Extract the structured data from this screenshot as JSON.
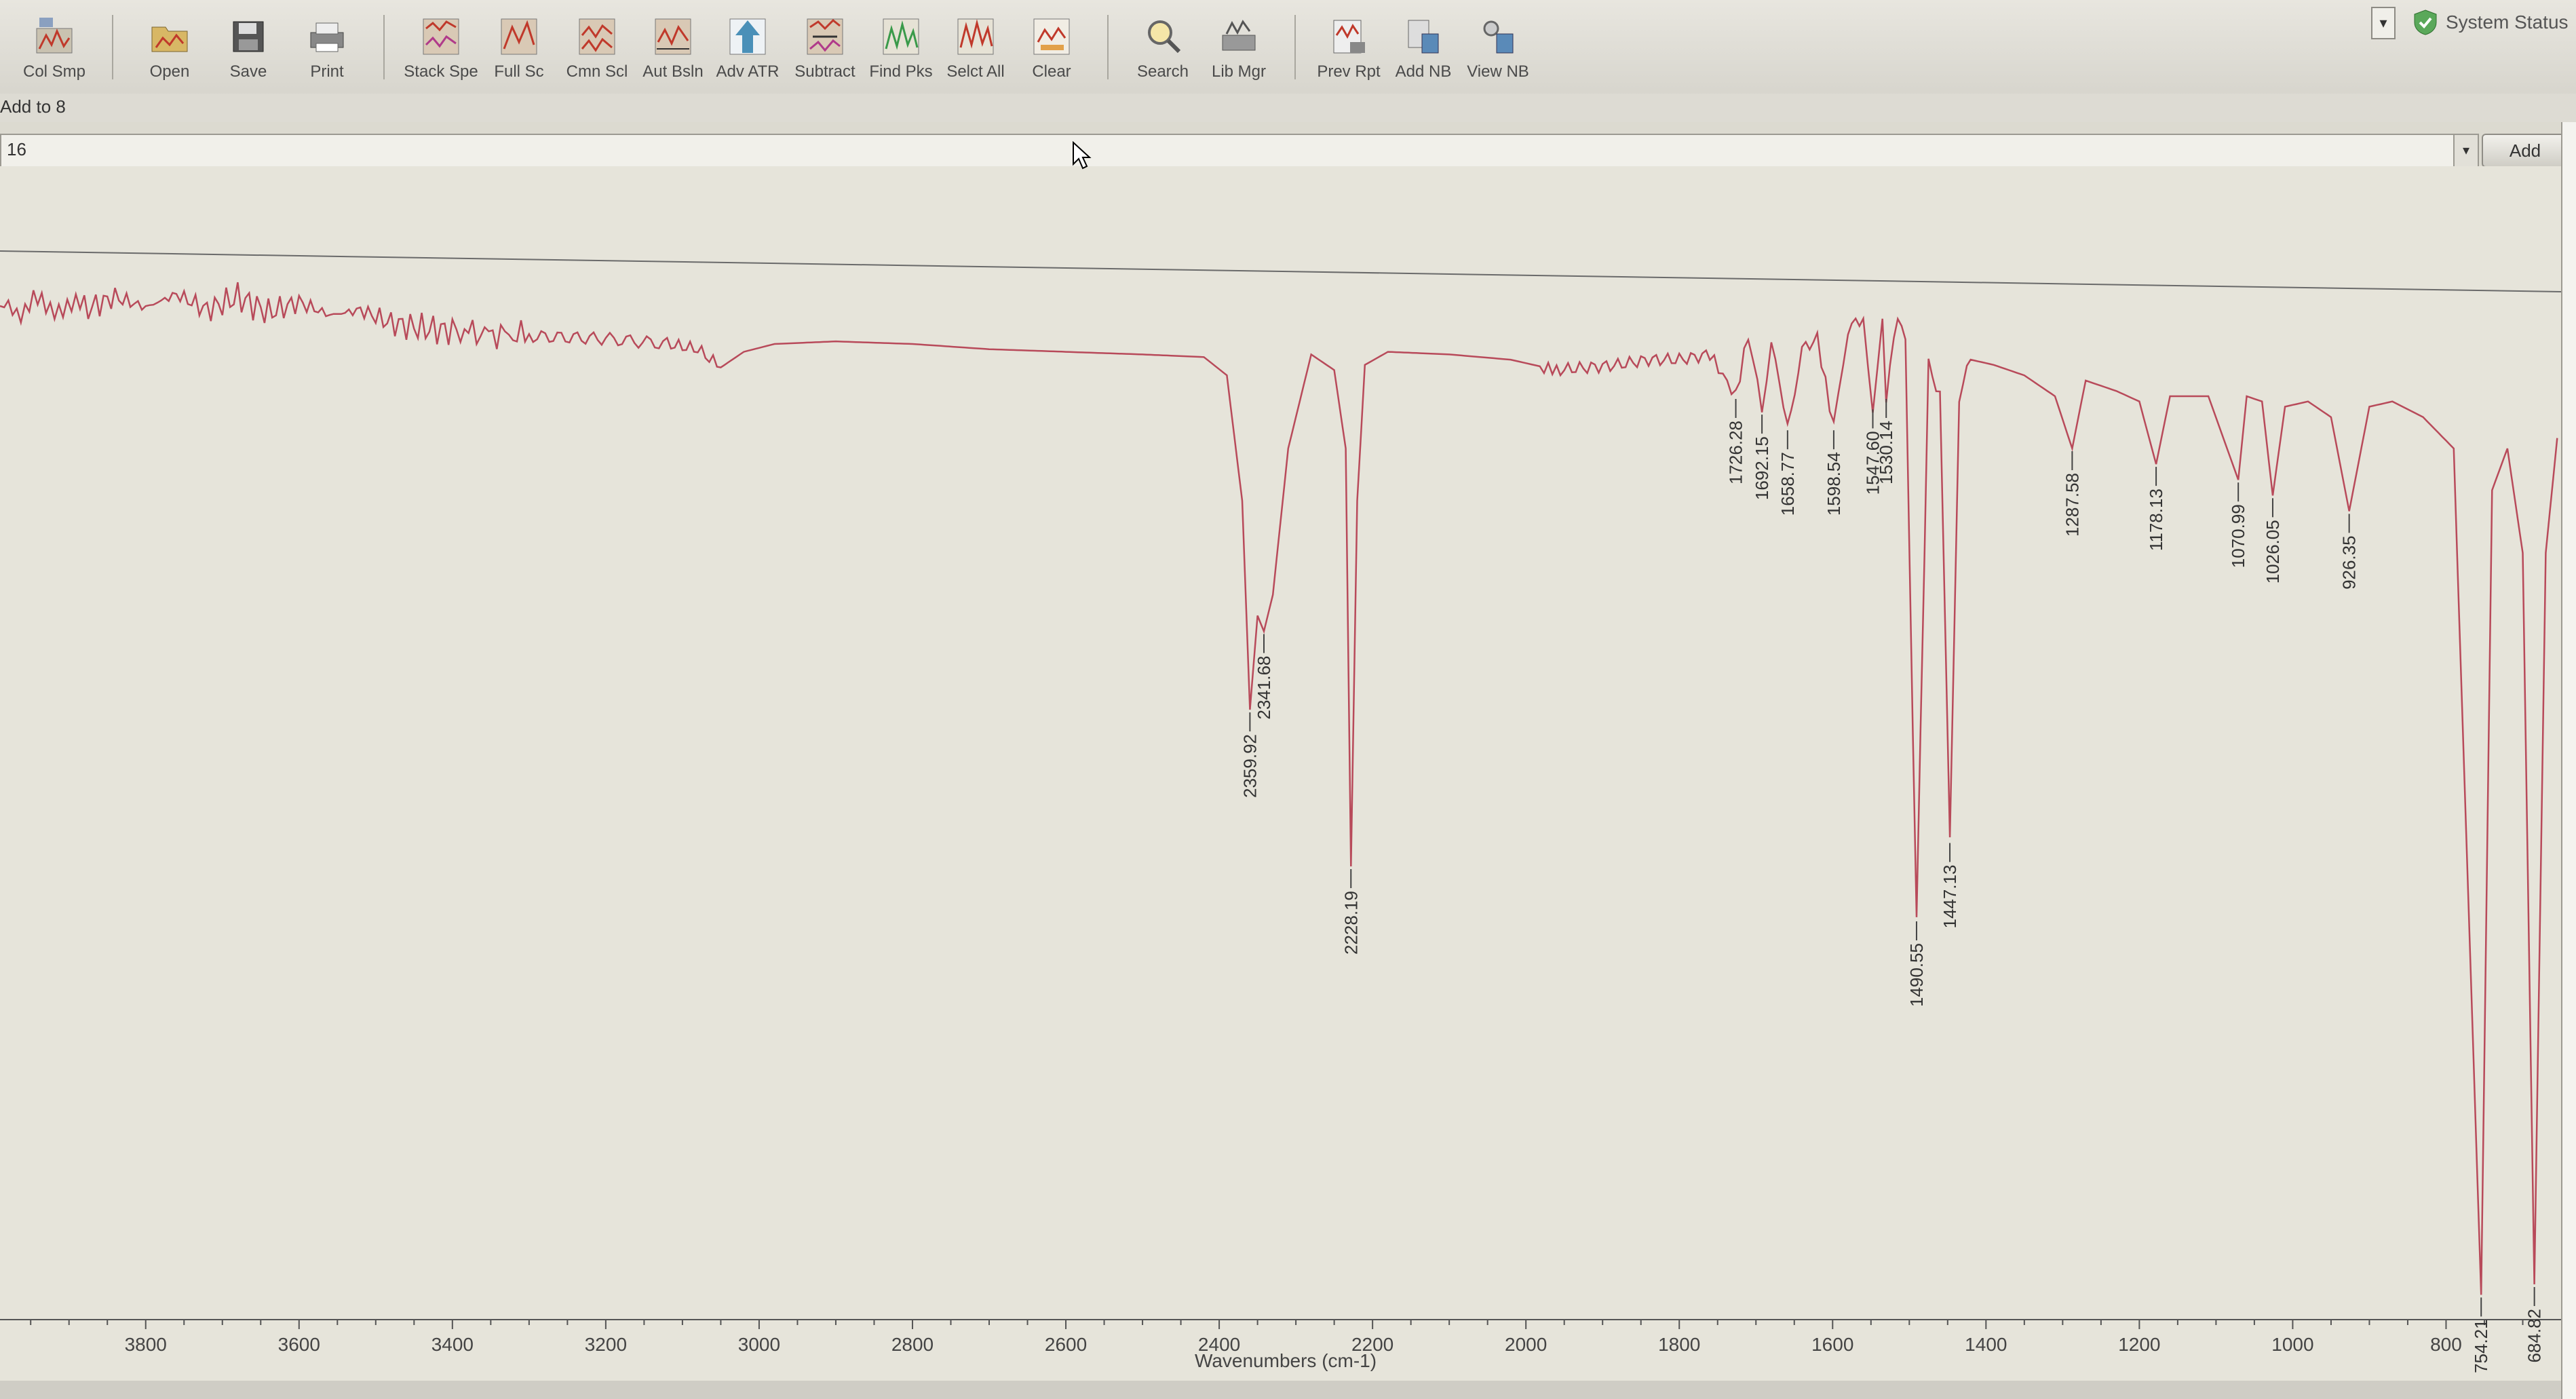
{
  "toolbar": {
    "buttons": [
      {
        "label": "Col Smp",
        "icon": "collect-sample-icon"
      },
      {
        "label": "Open",
        "icon": "folder-open-icon"
      },
      {
        "label": "Save",
        "icon": "save-disk-icon"
      },
      {
        "label": "Print",
        "icon": "printer-icon"
      },
      {
        "label": "Stack Spe",
        "icon": "stack-spectra-icon"
      },
      {
        "label": "Full Sc",
        "icon": "full-scale-icon"
      },
      {
        "label": "Cmn Scl",
        "icon": "common-scale-icon"
      },
      {
        "label": "Aut Bsln",
        "icon": "auto-baseline-icon"
      },
      {
        "label": "Adv ATR",
        "icon": "advanced-atr-icon"
      },
      {
        "label": "Subtract",
        "icon": "subtract-icon"
      },
      {
        "label": "Find Pks",
        "icon": "find-peaks-icon"
      },
      {
        "label": "Selct All",
        "icon": "select-all-icon"
      },
      {
        "label": "Clear",
        "icon": "clear-icon"
      },
      {
        "label": "Search",
        "icon": "search-icon"
      },
      {
        "label": "Lib Mgr",
        "icon": "library-manager-icon"
      },
      {
        "label": "Prev Rpt",
        "icon": "preview-report-icon"
      },
      {
        "label": "Add NB",
        "icon": "add-notebook-icon"
      },
      {
        "label": "View NB",
        "icon": "view-notebook-icon"
      }
    ],
    "system_status": "System Status"
  },
  "add_to": {
    "label": "Add to 8",
    "combo_value": "16",
    "add_button": "Add"
  },
  "chart_data": {
    "type": "line",
    "xlabel": "Wavenumbers (cm-1)",
    "x_ticks": [
      3800,
      3600,
      3400,
      3200,
      3000,
      2800,
      2600,
      2400,
      2200,
      2000,
      1800,
      1600,
      1400,
      1200,
      1000,
      800
    ],
    "x_ticks_labels": [
      "3800",
      "3600",
      "3400",
      "3200",
      "3000",
      "2800",
      "2600",
      "2400",
      "2200",
      "2000",
      "1800",
      "1600",
      "1400",
      "1200",
      "1000",
      "800"
    ],
    "xlim": [
      3990,
      650
    ],
    "x_reversed": true,
    "line_color": "#b84a5a",
    "peaks": [
      {
        "x": 2359.92,
        "label": "2359.92"
      },
      {
        "x": 2341.68,
        "label": "2341.68"
      },
      {
        "x": 2228.19,
        "label": "2228.19"
      },
      {
        "x": 1726.28,
        "label": "1726.28"
      },
      {
        "x": 1692.15,
        "label": "1692.15"
      },
      {
        "x": 1658.77,
        "label": "1658.77"
      },
      {
        "x": 1598.54,
        "label": "1598.54"
      },
      {
        "x": 1547.6,
        "label": "1547.60"
      },
      {
        "x": 1530.14,
        "label": "1530.14"
      },
      {
        "x": 1490.55,
        "label": "1490.55"
      },
      {
        "x": 1447.13,
        "label": "1447.13"
      },
      {
        "x": 1287.58,
        "label": "1287.58"
      },
      {
        "x": 1178.13,
        "label": "1178.13"
      },
      {
        "x": 1070.99,
        "label": "1070.99"
      },
      {
        "x": 1026.05,
        "label": "1026.05"
      },
      {
        "x": 926.35,
        "label": "926.35"
      },
      {
        "x": 754.21,
        "label": "754.21"
      },
      {
        "x": 684.82,
        "label": "684.82"
      }
    ],
    "spectrum": [
      [
        3990,
        0.04
      ],
      [
        3930,
        0.02
      ],
      [
        3880,
        0.035
      ],
      [
        3840,
        0.01
      ],
      [
        3800,
        0.03
      ],
      [
        3760,
        0.005
      ],
      [
        3720,
        0.035
      ],
      [
        3680,
        0.01
      ],
      [
        3640,
        0.04
      ],
      [
        3600,
        0.02
      ],
      [
        3560,
        0.045
      ],
      [
        3520,
        0.035
      ],
      [
        3480,
        0.06
      ],
      [
        3440,
        0.07
      ],
      [
        3400,
        0.075
      ],
      [
        3300,
        0.085
      ],
      [
        3200,
        0.09
      ],
      [
        3120,
        0.1
      ],
      [
        3080,
        0.11
      ],
      [
        3050,
        0.145
      ],
      [
        3020,
        0.115
      ],
      [
        2980,
        0.1
      ],
      [
        2900,
        0.095
      ],
      [
        2800,
        0.1
      ],
      [
        2700,
        0.11
      ],
      [
        2600,
        0.115
      ],
      [
        2500,
        0.12
      ],
      [
        2420,
        0.125
      ],
      [
        2390,
        0.16
      ],
      [
        2370,
        0.4
      ],
      [
        2359.92,
        0.8
      ],
      [
        2350,
        0.62
      ],
      [
        2341.68,
        0.65
      ],
      [
        2330,
        0.58
      ],
      [
        2310,
        0.3
      ],
      [
        2280,
        0.12
      ],
      [
        2250,
        0.15
      ],
      [
        2235,
        0.3
      ],
      [
        2228.19,
        1.1
      ],
      [
        2220,
        0.4
      ],
      [
        2210,
        0.14
      ],
      [
        2180,
        0.115
      ],
      [
        2100,
        0.12
      ],
      [
        2020,
        0.13
      ],
      [
        1960,
        0.15
      ],
      [
        1920,
        0.145
      ],
      [
        1880,
        0.14
      ],
      [
        1840,
        0.13
      ],
      [
        1800,
        0.13
      ],
      [
        1760,
        0.12
      ],
      [
        1726.28,
        0.2
      ],
      [
        1710,
        0.08
      ],
      [
        1692.15,
        0.23
      ],
      [
        1680,
        0.09
      ],
      [
        1658.77,
        0.26
      ],
      [
        1640,
        0.11
      ],
      [
        1620,
        0.09
      ],
      [
        1598.54,
        0.26
      ],
      [
        1580,
        0.07
      ],
      [
        1560,
        0.05
      ],
      [
        1547.6,
        0.22
      ],
      [
        1535,
        0.05
      ],
      [
        1530.14,
        0.2
      ],
      [
        1515,
        0.04
      ],
      [
        1505,
        0.1
      ],
      [
        1490.55,
        1.2
      ],
      [
        1475,
        0.14
      ],
      [
        1460,
        0.2
      ],
      [
        1447.13,
        1.05
      ],
      [
        1435,
        0.2
      ],
      [
        1420,
        0.13
      ],
      [
        1390,
        0.14
      ],
      [
        1350,
        0.16
      ],
      [
        1310,
        0.2
      ],
      [
        1287.58,
        0.3
      ],
      [
        1270,
        0.17
      ],
      [
        1230,
        0.19
      ],
      [
        1200,
        0.21
      ],
      [
        1178.13,
        0.33
      ],
      [
        1160,
        0.2
      ],
      [
        1110,
        0.2
      ],
      [
        1070.99,
        0.36
      ],
      [
        1060,
        0.2
      ],
      [
        1040,
        0.21
      ],
      [
        1026.05,
        0.39
      ],
      [
        1010,
        0.22
      ],
      [
        980,
        0.21
      ],
      [
        950,
        0.24
      ],
      [
        926.35,
        0.42
      ],
      [
        900,
        0.22
      ],
      [
        870,
        0.21
      ],
      [
        830,
        0.24
      ],
      [
        790,
        0.3
      ],
      [
        754.21,
        1.92
      ],
      [
        740,
        0.38
      ],
      [
        720,
        0.3
      ],
      [
        700,
        0.5
      ],
      [
        684.82,
        1.9
      ],
      [
        670,
        0.5
      ],
      [
        655,
        0.28
      ]
    ]
  }
}
